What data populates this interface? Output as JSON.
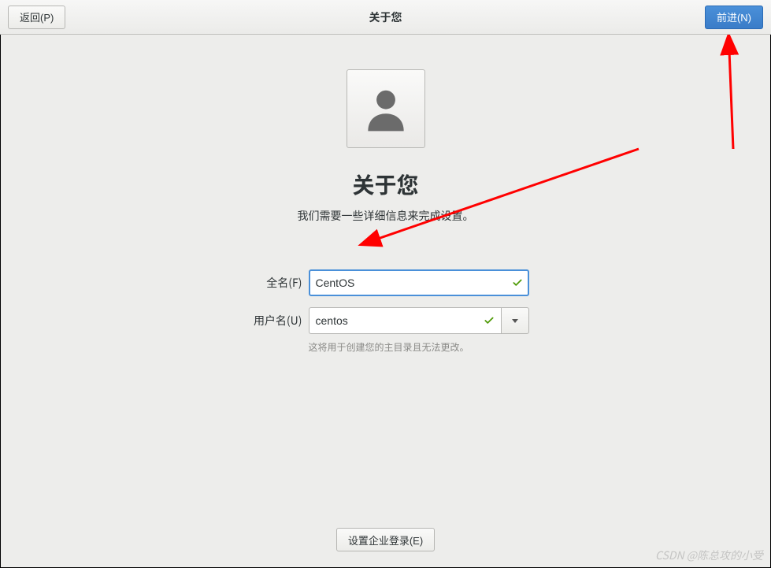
{
  "header": {
    "back_label": "返回(P)",
    "title": "关于您",
    "next_label": "前进(N)"
  },
  "main": {
    "heading": "关于您",
    "subtitle": "我们需要一些详细信息来完成设置。",
    "form": {
      "fullname_label": "全名(F)",
      "fullname_value": "CentOS",
      "username_label": "用户名(U)",
      "username_value": "centos",
      "username_hint": "这将用于创建您的主目录且无法更改。"
    },
    "enterprise_button": "设置企业登录(E)"
  },
  "watermark": "CSDN @陈总攻的小受",
  "icons": {
    "avatar": "user-icon",
    "check": "checkmark-icon",
    "dropdown": "triangle-down-icon"
  },
  "colors": {
    "primary": "#4a90d9",
    "success": "#4e9a06",
    "arrow": "#ff0000"
  }
}
